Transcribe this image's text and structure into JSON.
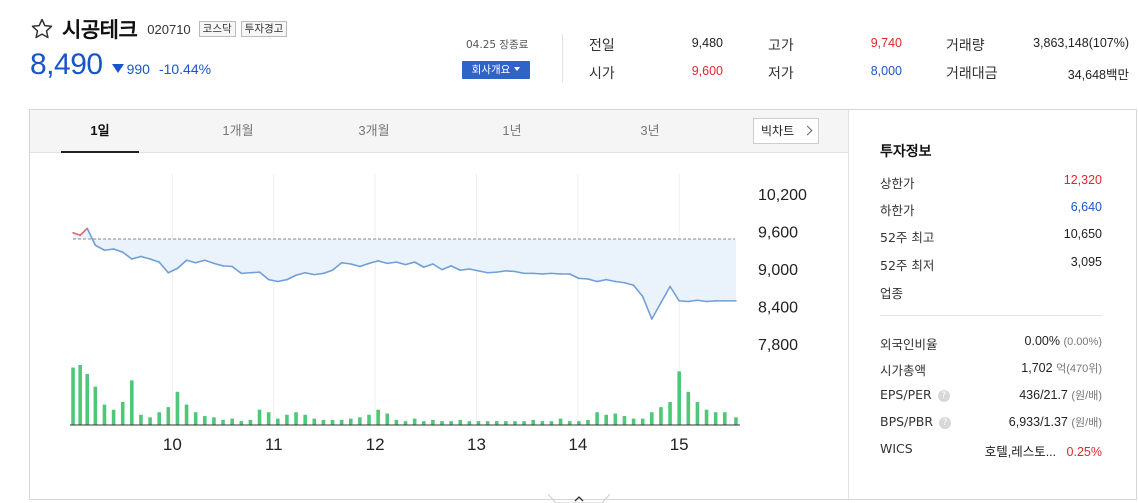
{
  "stock": {
    "name": "시공테크",
    "code": "020710",
    "tags": [
      "코스닥",
      "투자경고"
    ],
    "price": "8,490",
    "change": "990",
    "change_rate": "-10.44%",
    "close_label": "04.25 장종료",
    "company_button": "회사개요"
  },
  "stats": {
    "prev_label": "전일",
    "prev": "9,480",
    "open_label": "시가",
    "open": "9,600",
    "high_label": "고가",
    "high": "9,740",
    "low_label": "저가",
    "low": "8,000",
    "volume_label": "거래량",
    "volume": "3,863,148(107%)",
    "amount_label": "거래대금",
    "amount": "34,648백만"
  },
  "tabs": [
    "1일",
    "1개월",
    "3개월",
    "1년",
    "3년"
  ],
  "active_tab": "1일",
  "big_chart_label": "빅차트",
  "chart_data": {
    "type": "line",
    "title": "",
    "xlabel": "",
    "ylabel": "",
    "x_ticks": [
      10,
      11,
      12,
      13,
      14,
      15
    ],
    "x_range": [
      8.99,
      15.6
    ],
    "y_ticks": [
      "10,200",
      "9,600",
      "9,000",
      "8,400",
      "7,800"
    ],
    "y_tick_values": [
      10200,
      9600,
      9000,
      8400,
      7800
    ],
    "ylim": [
      7800,
      10200
    ],
    "prev_close": 9480,
    "colors": {
      "up": "#e06a6a",
      "down": "#6f9fd6",
      "fill": "#eaf2fc",
      "volume": "#4ec878",
      "grid": "#eeeeee"
    },
    "series": [
      {
        "x": [
          9.02,
          9.09,
          9.16,
          9.24,
          9.33,
          9.42,
          9.51,
          9.6,
          9.69,
          9.78,
          9.87,
          9.96,
          10.05,
          10.14,
          10.23,
          10.32,
          10.41,
          10.5,
          10.59,
          10.68,
          10.77,
          10.86,
          10.95,
          11.04,
          11.13,
          11.22,
          11.31,
          11.4,
          11.49,
          11.58,
          11.67,
          11.76,
          11.85,
          11.94,
          12.03,
          12.12,
          12.21,
          12.3,
          12.39,
          12.48,
          12.57,
          12.66,
          12.75,
          12.84,
          12.93,
          13.02,
          13.11,
          13.2,
          13.29,
          13.38,
          13.47,
          13.56,
          13.65,
          13.74,
          13.83,
          13.92,
          14.01,
          14.1,
          14.19,
          14.28,
          14.37,
          14.46,
          14.55,
          14.64,
          14.73,
          14.82,
          14.91,
          15.0,
          15.09,
          15.18,
          15.27,
          15.36,
          15.45,
          15.56
        ],
        "y": [
          9580,
          9540,
          9650,
          9380,
          9300,
          9320,
          9270,
          9160,
          9200,
          9160,
          9110,
          8940,
          9010,
          9140,
          9100,
          9140,
          9090,
          9050,
          9040,
          8930,
          8940,
          8950,
          8830,
          8800,
          8830,
          8900,
          8940,
          8910,
          8930,
          8980,
          9100,
          9080,
          9040,
          9090,
          9130,
          9090,
          9110,
          9070,
          9110,
          9030,
          9080,
          8990,
          9050,
          8980,
          9000,
          8970,
          8940,
          8950,
          8970,
          8960,
          8930,
          8930,
          8920,
          8930,
          8920,
          8920,
          8850,
          8840,
          8800,
          8830,
          8800,
          8780,
          8740,
          8560,
          8200,
          8460,
          8720,
          8490,
          8480,
          8500,
          8480,
          8490,
          8490,
          8490
        ]
      },
      {
        "name": "volume",
        "x": [
          9.02,
          9.09,
          9.16,
          9.24,
          9.33,
          9.42,
          9.51,
          9.6,
          9.69,
          9.78,
          9.87,
          9.96,
          10.05,
          10.14,
          10.23,
          10.32,
          10.41,
          10.5,
          10.59,
          10.68,
          10.77,
          10.86,
          10.95,
          11.04,
          11.13,
          11.22,
          11.31,
          11.4,
          11.49,
          11.58,
          11.67,
          11.76,
          11.85,
          11.94,
          12.03,
          12.12,
          12.21,
          12.3,
          12.39,
          12.48,
          12.57,
          12.66,
          12.75,
          12.84,
          12.93,
          13.02,
          13.11,
          13.2,
          13.29,
          13.38,
          13.47,
          13.56,
          13.65,
          13.74,
          13.83,
          13.92,
          14.01,
          14.1,
          14.19,
          14.28,
          14.37,
          14.46,
          14.55,
          14.64,
          14.73,
          14.82,
          14.91,
          15.0,
          15.09,
          15.18,
          15.27,
          15.36,
          15.45,
          15.56
        ],
        "y": [
          45,
          47,
          40,
          30,
          16,
          12,
          18,
          35,
          8,
          6,
          10,
          14,
          26,
          16,
          10,
          7,
          6,
          4,
          5,
          3,
          4,
          12,
          10,
          5,
          8,
          10,
          8,
          5,
          4,
          4,
          4,
          5,
          6,
          8,
          12,
          9,
          4,
          3,
          5,
          3,
          4,
          3,
          3,
          4,
          3,
          3,
          3,
          3,
          3,
          3,
          3,
          4,
          3,
          3,
          5,
          3,
          3,
          4,
          10,
          8,
          9,
          7,
          5,
          5,
          10,
          14,
          18,
          42,
          26,
          18,
          12,
          10,
          10,
          6
        ]
      }
    ]
  },
  "info": {
    "title": "투자정보",
    "rows": [
      {
        "label": "상한가",
        "value": "12,320"
      },
      {
        "label": "하한가",
        "value": "6,640"
      },
      {
        "label": "52주 최고",
        "value": "10,650"
      },
      {
        "label": "52주 최저",
        "value": "3,095"
      },
      {
        "label": "업종",
        "value": ""
      }
    ],
    "foreign_label": "외국인비율",
    "foreign_value": "0.00%",
    "foreign_sub": "(0.00%)",
    "mcap_label": "시가총액",
    "mcap_value": "1,702",
    "mcap_unit": "억",
    "mcap_sub": "(470위)",
    "eps_label": "EPS/PER",
    "eps_value": "436/21.7",
    "eps_sub": "(원/배)",
    "bps_label": "BPS/PBR",
    "bps_value": "6,933/1.37",
    "bps_sub": "(원/배)",
    "wics_label": "WICS",
    "wics_value": "호텔,레스토...",
    "wics_rate": "0.25%",
    "help_glyph": "?"
  }
}
